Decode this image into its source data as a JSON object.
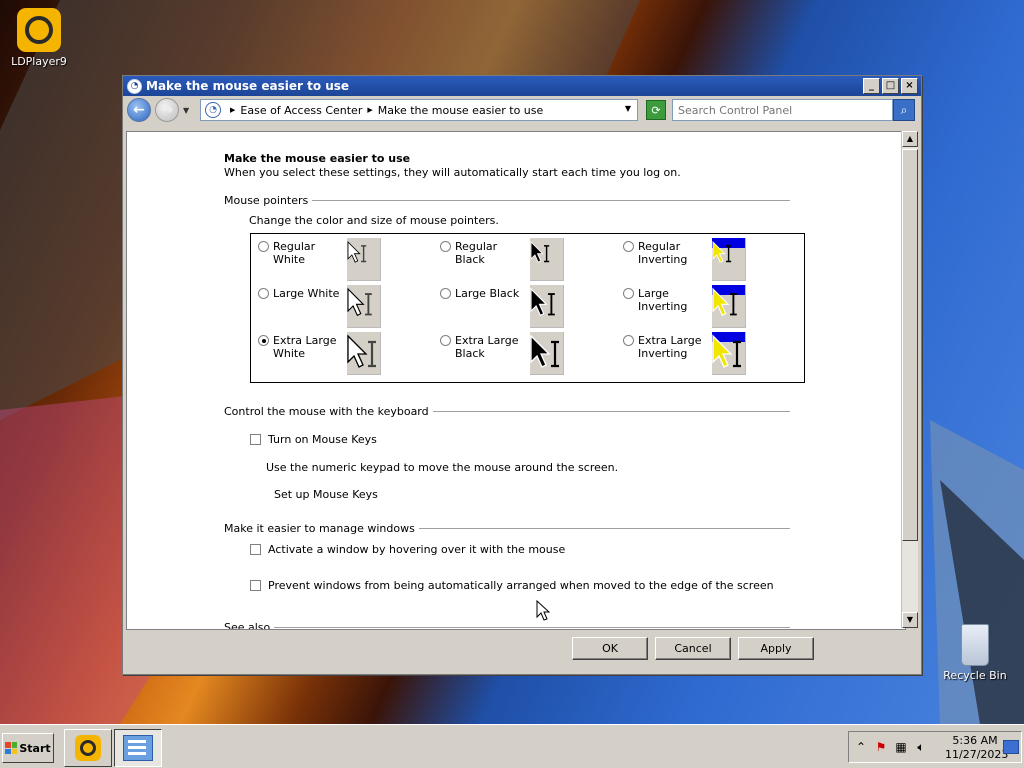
{
  "desktop": {
    "icons": [
      {
        "label": "LDPlayer9",
        "icon": "ldplayer-icon"
      },
      {
        "label": "Recycle Bin",
        "icon": "recycle-bin-icon"
      }
    ]
  },
  "window": {
    "title": "Make the mouse easier to use",
    "title_buttons": [
      "_",
      "□",
      "×"
    ],
    "address": {
      "crumbs": [
        "Ease of Access Center",
        "Make the mouse easier to use"
      ]
    },
    "search": {
      "placeholder": "Search Control Panel"
    }
  },
  "content": {
    "heading": "Make the mouse easier to use",
    "subheading": "When you select these settings, they will automatically start each time you log on.",
    "mouse_pointers": {
      "group_title": "Mouse pointers",
      "description": "Change the color and size of mouse pointers.",
      "options": [
        {
          "label": "Regular White",
          "scheme": "white",
          "size": "regular",
          "checked": false
        },
        {
          "label": "Regular Black",
          "scheme": "black",
          "size": "regular",
          "checked": false
        },
        {
          "label": "Regular Inverting",
          "scheme": "inverting",
          "size": "regular",
          "checked": false
        },
        {
          "label": "Large White",
          "scheme": "white",
          "size": "large",
          "checked": false
        },
        {
          "label": "Large Black",
          "scheme": "black",
          "size": "large",
          "checked": false
        },
        {
          "label": "Large Inverting",
          "scheme": "inverting",
          "size": "large",
          "checked": false
        },
        {
          "label": "Extra Large White",
          "scheme": "white",
          "size": "xlarge",
          "checked": true
        },
        {
          "label": "Extra Large Black",
          "scheme": "black",
          "size": "xlarge",
          "checked": false
        },
        {
          "label": "Extra Large Inverting",
          "scheme": "inverting",
          "size": "xlarge",
          "checked": false
        }
      ]
    },
    "keyboard": {
      "group_title": "Control the mouse with the keyboard",
      "mouse_keys_label": "Turn on Mouse Keys",
      "mouse_keys_desc": "Use the numeric keypad to move the mouse around the screen.",
      "setup_link": "Set up Mouse Keys"
    },
    "windows": {
      "group_title": "Make it easier to manage windows",
      "hover_label": "Activate a window by hovering over it with the mouse",
      "arrange_label": "Prevent windows from being automatically arranged when moved to the edge of the screen"
    },
    "see_also": "See also"
  },
  "buttons": {
    "ok": "OK",
    "cancel": "Cancel",
    "apply": "Apply"
  },
  "taskbar": {
    "start_label": "Start",
    "clock_time": "5:36 AM",
    "clock_date": "11/27/2023"
  },
  "colors": {
    "title_bar": "#1d4596",
    "invert_blue": "#0000e0"
  }
}
